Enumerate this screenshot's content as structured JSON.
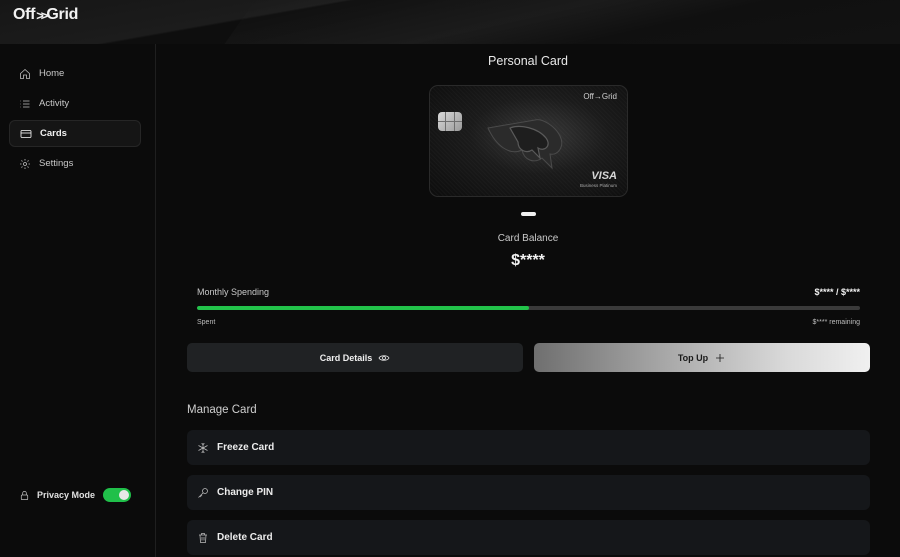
{
  "app": {
    "logo_left": "Off",
    "logo_arrows": ">>",
    "logo_right": "Grid"
  },
  "sidebar": {
    "items": [
      {
        "label": "Home",
        "icon": "home-icon"
      },
      {
        "label": "Activity",
        "icon": "list-icon"
      },
      {
        "label": "Cards",
        "icon": "card-icon",
        "active": true
      },
      {
        "label": "Settings",
        "icon": "gear-icon"
      }
    ],
    "privacy_label": "Privacy Mode",
    "privacy_enabled": true
  },
  "main": {
    "title": "Personal Card",
    "card": {
      "brand": "Off→Grid",
      "network": "VISA",
      "tier": "Business Platinum"
    },
    "balance_label": "Card Balance",
    "balance_value": "$****",
    "spending": {
      "label": "Monthly Spending",
      "amount": "$**** / $****",
      "spent_label": "Spent",
      "remaining_label": "$**** remaining",
      "progress": 0.5
    },
    "buttons": {
      "details": "Card Details",
      "topup": "Top Up"
    },
    "manage": {
      "title": "Manage Card",
      "items": [
        {
          "label": "Freeze Card",
          "icon": "snowflake-icon"
        },
        {
          "label": "Change PIN",
          "icon": "key-icon"
        },
        {
          "label": "Delete Card",
          "icon": "trash-icon"
        }
      ]
    }
  },
  "colors": {
    "accent": "#22c34a",
    "background": "#0b0b0b",
    "panel": "#15171a"
  }
}
